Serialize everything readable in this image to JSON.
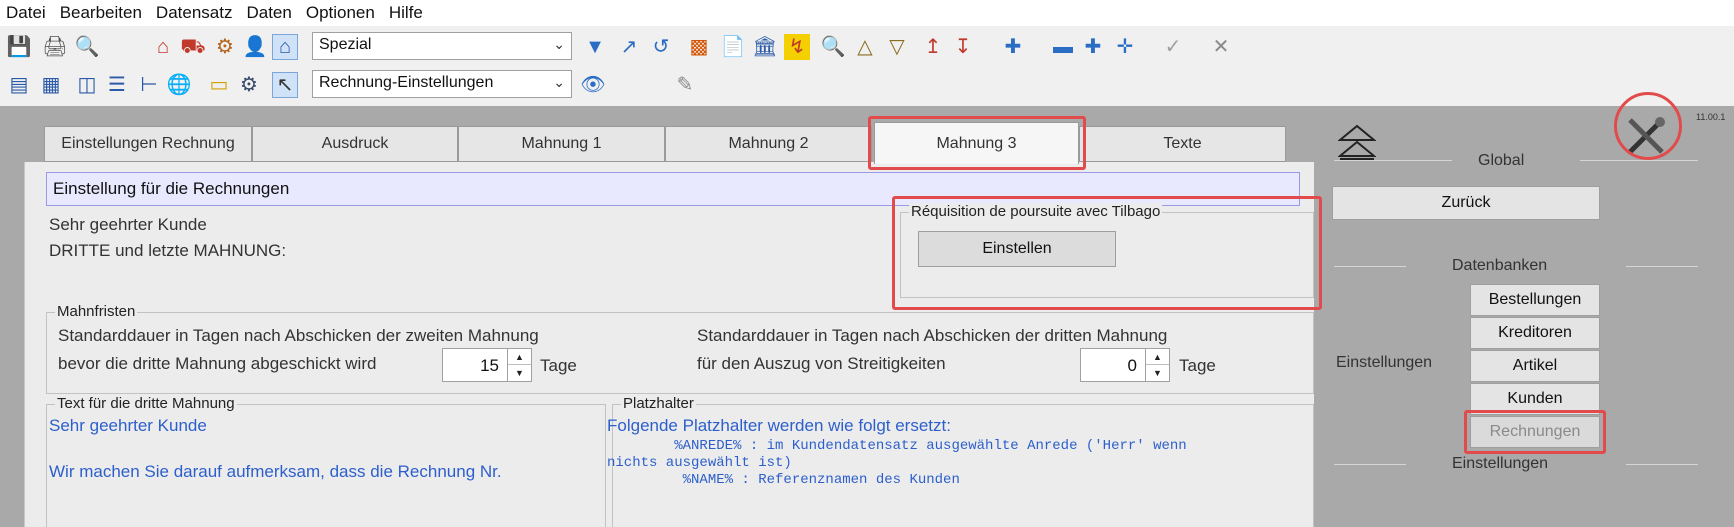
{
  "menu": [
    "Datei",
    "Bearbeiten",
    "Datensatz",
    "Daten",
    "Optionen",
    "Hilfe"
  ],
  "toolbar1": {
    "select_value": "Spezial",
    "icons": [
      "save-icon",
      "print-icon",
      "print-preview-icon",
      "home-red-icon",
      "truck-icon",
      "screw-icon",
      "user-icon",
      "home-blue-icon",
      "filter-icon",
      "export-icon",
      "import-icon",
      "chart-icon",
      "report-icon",
      "bank-icon",
      "transfer-icon",
      "search-icon",
      "triangle-up-icon",
      "triangle-down-icon",
      "arrow-up-icon",
      "arrow-down-icon",
      "plus-small-icon",
      "minus-icon",
      "plus-icon",
      "plus-large-icon",
      "check-icon",
      "close-icon"
    ]
  },
  "toolbar2": {
    "select_value": "Rechnung-Einstellungen",
    "icons": [
      "form-icon",
      "table-icon",
      "grid-icon",
      "tree-icon",
      "tree-branch-icon",
      "globe-icon",
      "scanner-icon",
      "gear-icon",
      "cursor-icon",
      "eye-icon",
      "pencil-icon"
    ]
  },
  "tabs": [
    "Einstellungen Rechnung",
    "Ausdruck",
    "Mahnung 1",
    "Mahnung 2",
    "Mahnung 3",
    "Texte"
  ],
  "active_tab": "Mahnung 3",
  "section_header": "Einstellung für die Rechnungen",
  "greeting_line1": "Sehr geehrter Kunde",
  "greeting_line2": "DRITTE und letzte MAHNUNG:",
  "tilbago": {
    "legend": "Réquisition de poursuite avec Tilbago",
    "button": "Einstellen"
  },
  "mahnfristen": {
    "legend": "Mahnfristen",
    "left_line1": "Standarddauer in Tagen nach Abschicken der zweiten Mahnung",
    "left_line2": "bevor die dritte Mahnung abgeschickt wird",
    "left_value": "15",
    "left_unit": "Tage",
    "right_line1": "Standarddauer in Tagen nach Abschicken der dritten Mahnung",
    "right_line2": "für den Auszug von Streitigkeiten",
    "right_value": "0",
    "right_unit": "Tage"
  },
  "text_group": {
    "legend": "Text für die dritte Mahnung",
    "line1": "Sehr geehrter Kunde",
    "line2": "Wir machen Sie darauf aufmerksam, dass die Rechnung Nr."
  },
  "platzhalter": {
    "legend": "Platzhalter",
    "intro": "Folgende Platzhalter werden wie folgt ersetzt:",
    "line1": "        %ANREDE% : im Kundendatensatz ausgewählte Anrede ('Herr' wenn",
    "line2": "nichts ausgewählt ist)",
    "line3": "         %NAME% : Referenznamen des Kunden"
  },
  "right": {
    "version": "11.00.1",
    "global_label": "Global",
    "back_button": "Zurück",
    "datenbanken_label": "Datenbanken",
    "einstellungen_label": "Einstellungen",
    "einstellungen_label2": "Einstellungen",
    "db_buttons": [
      "Bestellungen",
      "Kreditoren",
      "Artikel",
      "Kunden",
      "Rechnungen"
    ]
  }
}
